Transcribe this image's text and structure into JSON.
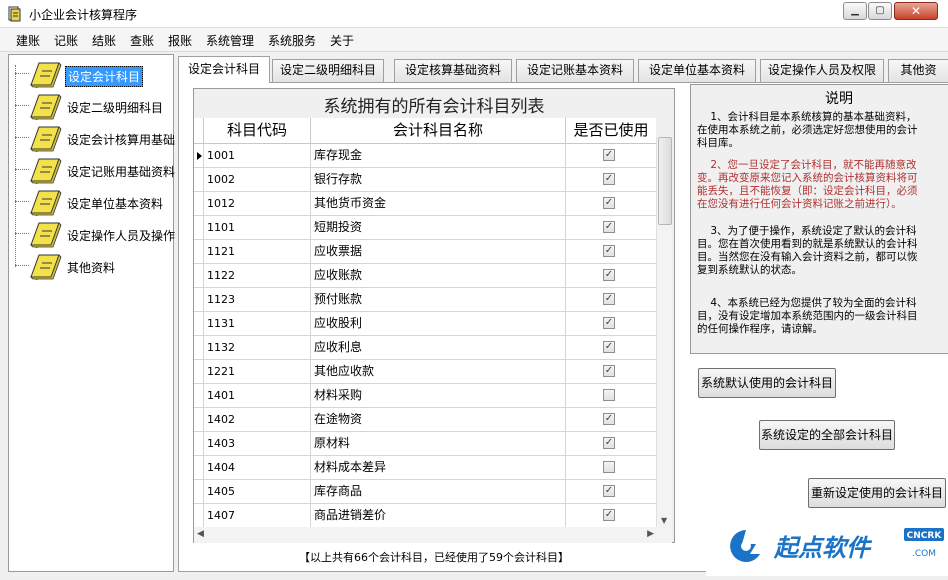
{
  "window": {
    "title": "小企业会计核算程序"
  },
  "menu": [
    "建账",
    "记账",
    "结账",
    "查账",
    "报账",
    "系统管理",
    "系统服务",
    "关于"
  ],
  "tree": {
    "items": [
      {
        "label": "设定会计科目",
        "selected": true
      },
      {
        "label": "设定二级明细科目"
      },
      {
        "label": "设定会计核算用基础"
      },
      {
        "label": "设定记账用基础资料"
      },
      {
        "label": "设定单位基本资料"
      },
      {
        "label": "设定操作人员及操作"
      },
      {
        "label": "其他资料"
      }
    ]
  },
  "tabs": [
    {
      "label": "设定会计科目",
      "active": true
    },
    {
      "label": "设定二级明细科目"
    },
    {
      "label": "设定核算基础资料"
    },
    {
      "label": "设定记账基本资料"
    },
    {
      "label": "设定单位基本资料"
    },
    {
      "label": "设定操作人员及权限"
    },
    {
      "label": "其他资"
    }
  ],
  "grid": {
    "title": "系统拥有的所有会计科目列表",
    "columns": {
      "code": "科目代码",
      "name": "会计科目名称",
      "used": "是否已使用"
    },
    "rows": [
      {
        "code": "1001",
        "name": "库存现金",
        "used": true
      },
      {
        "code": "1002",
        "name": "银行存款",
        "used": true
      },
      {
        "code": "1012",
        "name": "其他货币资金",
        "used": true
      },
      {
        "code": "1101",
        "name": "短期投资",
        "used": true
      },
      {
        "code": "1121",
        "name": "应收票据",
        "used": true
      },
      {
        "code": "1122",
        "name": "应收账款",
        "used": true
      },
      {
        "code": "1123",
        "name": "预付账款",
        "used": true
      },
      {
        "code": "1131",
        "name": "应收股利",
        "used": true
      },
      {
        "code": "1132",
        "name": "应收利息",
        "used": true
      },
      {
        "code": "1221",
        "name": "其他应收款",
        "used": true
      },
      {
        "code": "1401",
        "name": "材料采购",
        "used": false
      },
      {
        "code": "1402",
        "name": "在途物资",
        "used": true
      },
      {
        "code": "1403",
        "name": "原材料",
        "used": true
      },
      {
        "code": "1404",
        "name": "材料成本差异",
        "used": false
      },
      {
        "code": "1405",
        "name": "库存商品",
        "used": true
      },
      {
        "code": "1407",
        "name": "商品进销差价",
        "used": true
      }
    ],
    "summary": "【以上共有66个会计科目，已经使用了59个会计科目】"
  },
  "explanation": {
    "title": "说明",
    "paragraphs": [
      {
        "text": "    1、会计科目是本系统核算的基本基础资料，\n在使用本系统之前，必须选定好您想使用的会计\n科目库。",
        "red": false
      },
      {
        "text": "    2、您一旦设定了会计科目，就不能再随意改\n变。再改变原来您记入系统的会计核算资料将可\n能丢失，且不能恢复（即：设定会计科目，必须\n在您没有进行任何会计资料记账之前进行）。",
        "red": true
      },
      {
        "text": "    3、为了便于操作，系统设定了默认的会计科\n目。您在首次使用看到的就是系统默认的会计科\n目。当然您在没有输入会计资料之前，都可以恢\n复到系统默认的状态。",
        "red": false
      },
      {
        "text": "    4、本系统已经为您提供了较为全面的会计科\n目，没有设定增加本系统范围内的一级会计科目\n的任何操作程序，请谅解。",
        "red": false
      }
    ]
  },
  "buttons": {
    "default_subjects": "系统默认使用的会计科目",
    "all_subjects": "系统设定的全部会计科目",
    "reset_subjects": "重新设定使用的会计科目"
  },
  "watermark": {
    "brand": "起点软件",
    "badge": "CNCRK",
    "suffix": ".COM"
  },
  "colors": {
    "selection": "#3399ff",
    "book_yellow": "#f2e14a",
    "warning_text": "#b03030",
    "watermark_blue": "#1a73c7"
  }
}
